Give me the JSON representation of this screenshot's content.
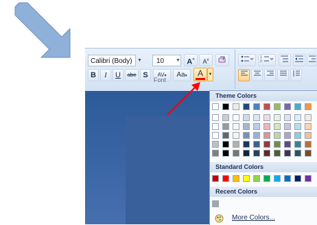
{
  "toolbar": {
    "font_name": "Calibri (Body)",
    "font_size": "10",
    "grow_font": "A",
    "shrink_font": "A",
    "bold": "B",
    "italic": "I",
    "underline": "U",
    "strikethrough": "abe",
    "shadow": "S",
    "spacing": "AV",
    "change_case": "Aa",
    "font_color": "A",
    "font_color_value": "#ff0000",
    "group_label": "Font"
  },
  "palette": {
    "theme_header": "Theme Colors",
    "theme_top_row": [
      "#ffffff",
      "#000000",
      "#eeece1",
      "#1f497d",
      "#4f81bd",
      "#c0504d",
      "#9bbb59",
      "#8064a2",
      "#4bacc6",
      "#f79646"
    ],
    "standard_header": "Standard Colors",
    "standard_colors": [
      "#c00000",
      "#ff0000",
      "#ffc000",
      "#ffff00",
      "#92d050",
      "#00b050",
      "#00b0f0",
      "#0070c0",
      "#002060",
      "#7030a0"
    ],
    "recent_header": "Recent Colors",
    "recent_colors": [
      "#a6a6a6"
    ],
    "more_colors": "More Colors..."
  }
}
